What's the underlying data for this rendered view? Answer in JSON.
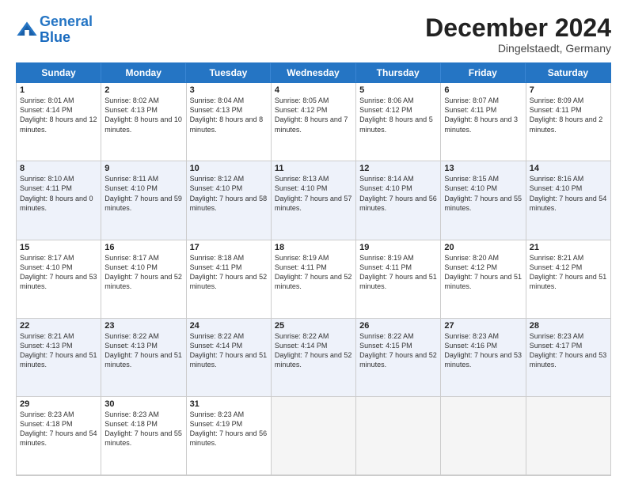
{
  "header": {
    "logo_line1": "General",
    "logo_line2": "Blue",
    "month": "December 2024",
    "location": "Dingelstaedt, Germany"
  },
  "days": [
    "Sunday",
    "Monday",
    "Tuesday",
    "Wednesday",
    "Thursday",
    "Friday",
    "Saturday"
  ],
  "weeks": [
    [
      {
        "day": "1",
        "rise": "8:01 AM",
        "set": "4:14 PM",
        "daylight": "8 hours and 12 minutes."
      },
      {
        "day": "2",
        "rise": "8:02 AM",
        "set": "4:13 PM",
        "daylight": "8 hours and 10 minutes."
      },
      {
        "day": "3",
        "rise": "8:04 AM",
        "set": "4:13 PM",
        "daylight": "8 hours and 8 minutes."
      },
      {
        "day": "4",
        "rise": "8:05 AM",
        "set": "4:12 PM",
        "daylight": "8 hours and 7 minutes."
      },
      {
        "day": "5",
        "rise": "8:06 AM",
        "set": "4:12 PM",
        "daylight": "8 hours and 5 minutes."
      },
      {
        "day": "6",
        "rise": "8:07 AM",
        "set": "4:11 PM",
        "daylight": "8 hours and 3 minutes."
      },
      {
        "day": "7",
        "rise": "8:09 AM",
        "set": "4:11 PM",
        "daylight": "8 hours and 2 minutes."
      }
    ],
    [
      {
        "day": "8",
        "rise": "8:10 AM",
        "set": "4:11 PM",
        "daylight": "8 hours and 0 minutes."
      },
      {
        "day": "9",
        "rise": "8:11 AM",
        "set": "4:10 PM",
        "daylight": "7 hours and 59 minutes."
      },
      {
        "day": "10",
        "rise": "8:12 AM",
        "set": "4:10 PM",
        "daylight": "7 hours and 58 minutes."
      },
      {
        "day": "11",
        "rise": "8:13 AM",
        "set": "4:10 PM",
        "daylight": "7 hours and 57 minutes."
      },
      {
        "day": "12",
        "rise": "8:14 AM",
        "set": "4:10 PM",
        "daylight": "7 hours and 56 minutes."
      },
      {
        "day": "13",
        "rise": "8:15 AM",
        "set": "4:10 PM",
        "daylight": "7 hours and 55 minutes."
      },
      {
        "day": "14",
        "rise": "8:16 AM",
        "set": "4:10 PM",
        "daylight": "7 hours and 54 minutes."
      }
    ],
    [
      {
        "day": "15",
        "rise": "8:17 AM",
        "set": "4:10 PM",
        "daylight": "7 hours and 53 minutes."
      },
      {
        "day": "16",
        "rise": "8:17 AM",
        "set": "4:10 PM",
        "daylight": "7 hours and 52 minutes."
      },
      {
        "day": "17",
        "rise": "8:18 AM",
        "set": "4:11 PM",
        "daylight": "7 hours and 52 minutes."
      },
      {
        "day": "18",
        "rise": "8:19 AM",
        "set": "4:11 PM",
        "daylight": "7 hours and 52 minutes."
      },
      {
        "day": "19",
        "rise": "8:19 AM",
        "set": "4:11 PM",
        "daylight": "7 hours and 51 minutes."
      },
      {
        "day": "20",
        "rise": "8:20 AM",
        "set": "4:12 PM",
        "daylight": "7 hours and 51 minutes."
      },
      {
        "day": "21",
        "rise": "8:21 AM",
        "set": "4:12 PM",
        "daylight": "7 hours and 51 minutes."
      }
    ],
    [
      {
        "day": "22",
        "rise": "8:21 AM",
        "set": "4:13 PM",
        "daylight": "7 hours and 51 minutes."
      },
      {
        "day": "23",
        "rise": "8:22 AM",
        "set": "4:13 PM",
        "daylight": "7 hours and 51 minutes."
      },
      {
        "day": "24",
        "rise": "8:22 AM",
        "set": "4:14 PM",
        "daylight": "7 hours and 51 minutes."
      },
      {
        "day": "25",
        "rise": "8:22 AM",
        "set": "4:14 PM",
        "daylight": "7 hours and 52 minutes."
      },
      {
        "day": "26",
        "rise": "8:22 AM",
        "set": "4:15 PM",
        "daylight": "7 hours and 52 minutes."
      },
      {
        "day": "27",
        "rise": "8:23 AM",
        "set": "4:16 PM",
        "daylight": "7 hours and 53 minutes."
      },
      {
        "day": "28",
        "rise": "8:23 AM",
        "set": "4:17 PM",
        "daylight": "7 hours and 53 minutes."
      }
    ],
    [
      {
        "day": "29",
        "rise": "8:23 AM",
        "set": "4:18 PM",
        "daylight": "7 hours and 54 minutes."
      },
      {
        "day": "30",
        "rise": "8:23 AM",
        "set": "4:18 PM",
        "daylight": "7 hours and 55 minutes."
      },
      {
        "day": "31",
        "rise": "8:23 AM",
        "set": "4:19 PM",
        "daylight": "7 hours and 56 minutes."
      },
      null,
      null,
      null,
      null
    ]
  ]
}
